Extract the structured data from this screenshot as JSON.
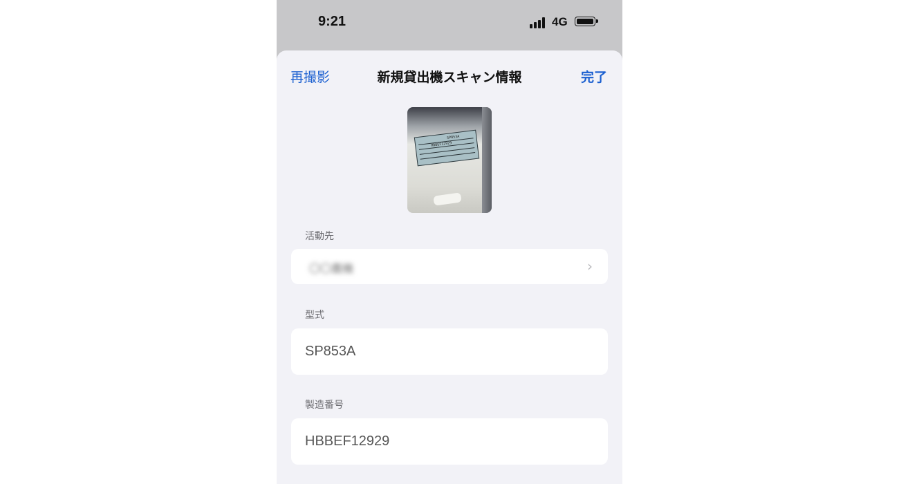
{
  "status_bar": {
    "time": "9:21",
    "network": "4G",
    "signal_bars": 4,
    "battery_level": 1.0
  },
  "navbar": {
    "left_label": "再撮影",
    "title": "新規貸出機スキャン情報",
    "right_label": "完了",
    "accent_color": "#1a5fd0"
  },
  "photo": {
    "plate_model_text": "SP853A",
    "plate_serial_text": "HBBEF12929"
  },
  "fields": {
    "activity": {
      "label": "活動先",
      "value": "〇〇農機",
      "chevron": "chevron-right-icon"
    },
    "model": {
      "label": "型式",
      "value": "SP853A"
    },
    "serial": {
      "label": "製造番号",
      "value": "HBBEF12929"
    }
  }
}
